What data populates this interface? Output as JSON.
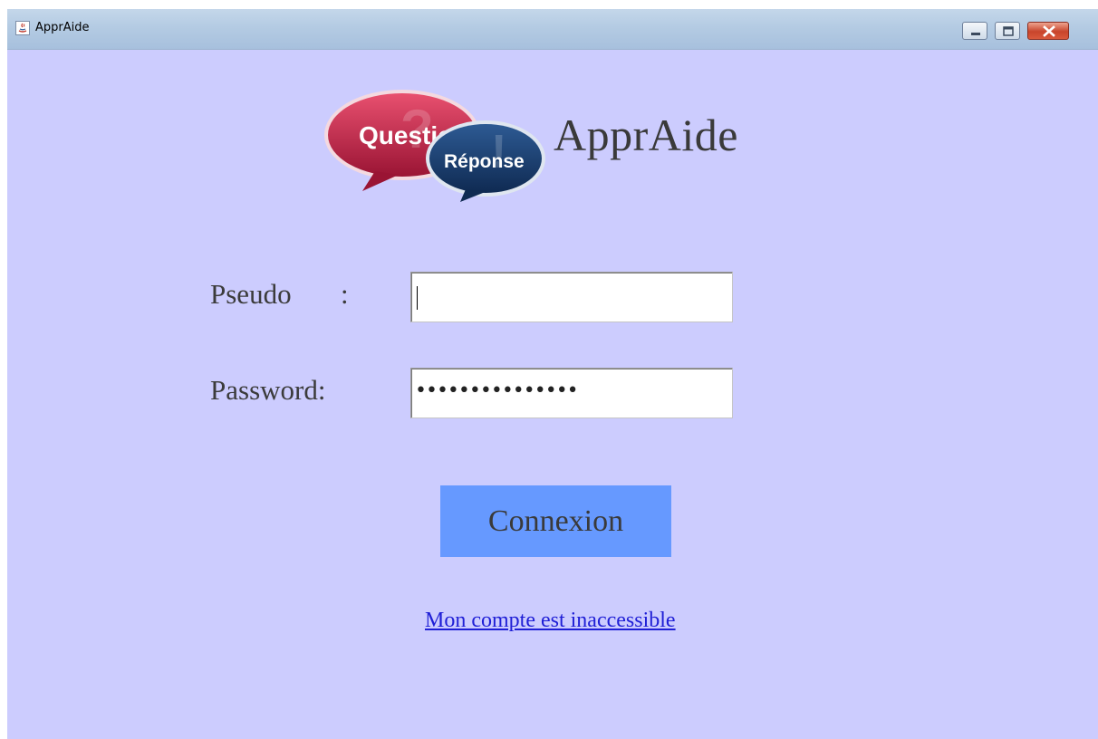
{
  "window": {
    "title": "ApprAide",
    "controls": [
      "minimize-icon",
      "maximize-icon",
      "close-icon"
    ],
    "background": "#ccccfe"
  },
  "header": {
    "logo_bubble_left": "Question",
    "logo_bubble_right": "Réponse",
    "app_name": "ApprAide"
  },
  "form": {
    "pseudo_label": "Pseudo",
    "pseudo_colon": ":",
    "pseudo_value": "",
    "password_label": "Password:",
    "password_value": "•••••••••••••••"
  },
  "actions": {
    "connexion_label": "Connexion",
    "connexion_color": "#6699ff",
    "inaccessible_link": "Mon compte est inaccessible",
    "link_color": "#1f1fd6"
  }
}
